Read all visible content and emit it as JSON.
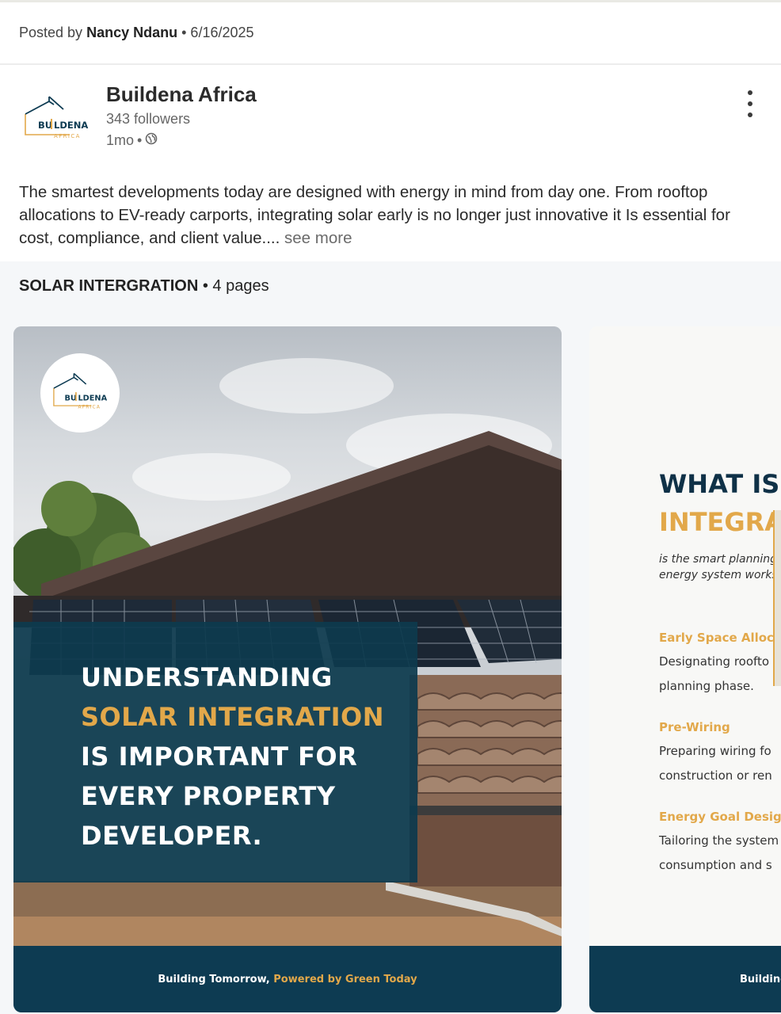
{
  "header": {
    "posted_prefix": "Posted by",
    "author": "Nancy Ndanu",
    "date": "• 6/16/2025"
  },
  "company": {
    "name": "Buildena Africa",
    "followers": "343 followers",
    "age": "1mo",
    "dot": "•",
    "logo_text_main": "BUILDENA",
    "logo_text_sub": "AFRICA"
  },
  "post": {
    "text": "The smartest developments today are designed with energy in mind from day one. From rooftop allocations to EV-ready carports, integrating solar early is no longer just innovative  it Is essential for cost, compliance, and client value....",
    "see_more": "see more"
  },
  "document": {
    "title": "SOLAR INTERGRATION",
    "pages": "• 4 pages"
  },
  "slide1": {
    "headline_1": "UNDERSTANDING",
    "headline_2": "SOLAR INTEGRATION",
    "headline_3": "IS IMPORTANT FOR",
    "headline_4": "EVERY PROPERTY",
    "headline_5": "DEVELOPER.",
    "footer_a": "Building Tomorrow,",
    "footer_b": "Powered by Green Today"
  },
  "slide2": {
    "heading_1": "WHAT IS",
    "heading_2": "INTEGRA",
    "intro_1": "is the smart planning",
    "intro_2": "energy system works",
    "item1_title": "Early Space Alloca",
    "item1_body_1": "Designating roofto",
    "item1_body_2": "planning phase.",
    "item2_title": "Pre-Wiring",
    "item2_body_1": "Preparing wiring fo",
    "item2_body_2": "construction or ren",
    "item3_title": "Energy Goal Desig",
    "item3_body_1": "Tailoring the system",
    "item3_body_2": "consumption and s",
    "footer": "Building"
  },
  "colors": {
    "brand_navy": "#0d3b52",
    "brand_gold": "#e2a84a"
  },
  "icons": [
    "globe-icon",
    "more-options-icon",
    "buildena-logo"
  ]
}
